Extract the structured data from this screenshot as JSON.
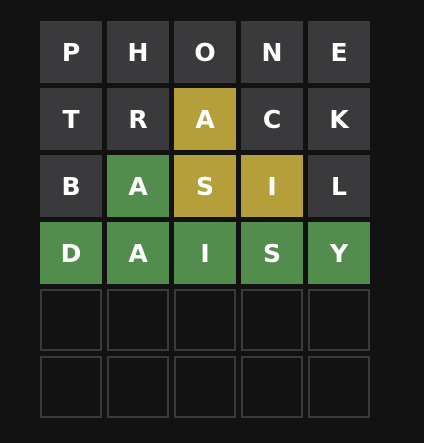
{
  "colors": {
    "background": "#121213",
    "absent": "#3a3a3c",
    "present": "#b59f3b",
    "correct": "#538d4e",
    "empty_border": "#3a3a3c",
    "text": "#ffffff"
  },
  "board": {
    "rows": [
      {
        "tiles": [
          {
            "letter": "P",
            "state": "absent"
          },
          {
            "letter": "H",
            "state": "absent"
          },
          {
            "letter": "O",
            "state": "absent"
          },
          {
            "letter": "N",
            "state": "absent"
          },
          {
            "letter": "E",
            "state": "absent"
          }
        ]
      },
      {
        "tiles": [
          {
            "letter": "T",
            "state": "absent"
          },
          {
            "letter": "R",
            "state": "absent"
          },
          {
            "letter": "A",
            "state": "present"
          },
          {
            "letter": "C",
            "state": "absent"
          },
          {
            "letter": "K",
            "state": "absent"
          }
        ]
      },
      {
        "tiles": [
          {
            "letter": "B",
            "state": "absent"
          },
          {
            "letter": "A",
            "state": "correct"
          },
          {
            "letter": "S",
            "state": "present"
          },
          {
            "letter": "I",
            "state": "present"
          },
          {
            "letter": "L",
            "state": "absent"
          }
        ]
      },
      {
        "tiles": [
          {
            "letter": "D",
            "state": "correct"
          },
          {
            "letter": "A",
            "state": "correct"
          },
          {
            "letter": "I",
            "state": "correct"
          },
          {
            "letter": "S",
            "state": "correct"
          },
          {
            "letter": "Y",
            "state": "correct"
          }
        ]
      },
      {
        "tiles": [
          {
            "letter": "",
            "state": "empty"
          },
          {
            "letter": "",
            "state": "empty"
          },
          {
            "letter": "",
            "state": "empty"
          },
          {
            "letter": "",
            "state": "empty"
          },
          {
            "letter": "",
            "state": "empty"
          }
        ]
      },
      {
        "tiles": [
          {
            "letter": "",
            "state": "empty"
          },
          {
            "letter": "",
            "state": "empty"
          },
          {
            "letter": "",
            "state": "empty"
          },
          {
            "letter": "",
            "state": "empty"
          },
          {
            "letter": "",
            "state": "empty"
          }
        ]
      }
    ]
  }
}
